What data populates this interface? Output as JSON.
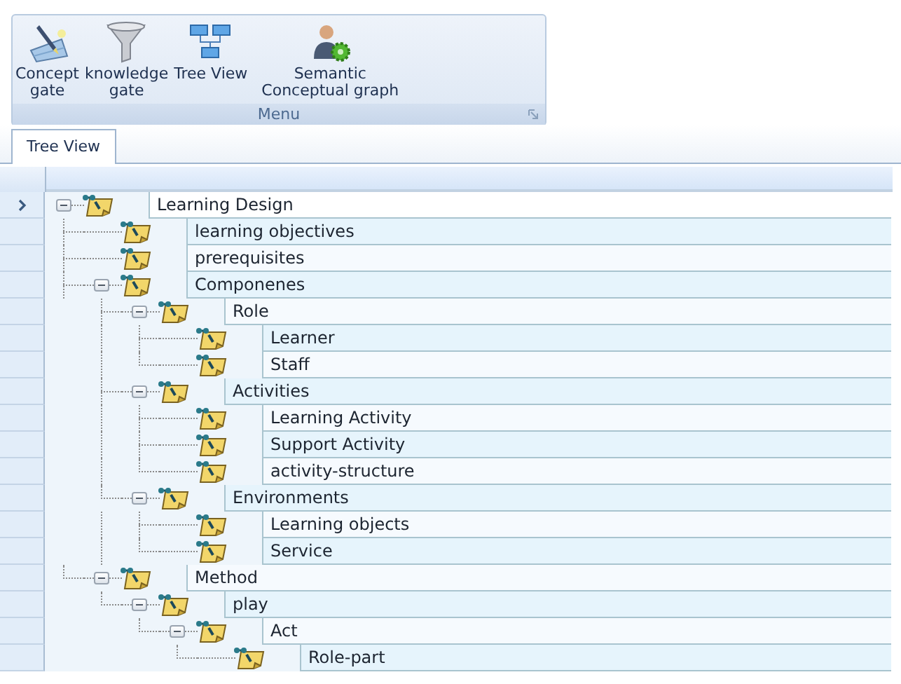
{
  "ribbon": {
    "buttons": [
      {
        "kind": "concept",
        "label": "Concept\ngate"
      },
      {
        "kind": "funnel",
        "label": "knowledge\ngate"
      },
      {
        "kind": "tree",
        "label": "Tree View"
      },
      {
        "kind": "person",
        "label": "Semantic\nConceptual graph"
      }
    ],
    "group_label": "Menu"
  },
  "tabs": [
    {
      "label": "Tree View",
      "selected": true
    }
  ],
  "tree": {
    "nodes": [
      {
        "label": "Learning Design",
        "expanded": true,
        "selected": true,
        "children": [
          {
            "label": "learning objectives",
            "selected": false
          },
          {
            "label": "prerequisites",
            "selected": false
          },
          {
            "label": "Componenes",
            "expanded": true,
            "selected": false,
            "children": [
              {
                "label": "Role",
                "expanded": true,
                "selected": false,
                "children": [
                  {
                    "label": "Learner",
                    "selected": false
                  },
                  {
                    "label": "Staff",
                    "selected": false
                  }
                ]
              },
              {
                "label": "Activities",
                "expanded": true,
                "selected": false,
                "children": [
                  {
                    "label": "Learning Activity",
                    "selected": false
                  },
                  {
                    "label": "Support Activity",
                    "selected": false
                  },
                  {
                    "label": "activity-structure",
                    "selected": false
                  }
                ]
              },
              {
                "label": "Environments",
                "expanded": true,
                "selected": false,
                "children": [
                  {
                    "label": "Learning objects",
                    "selected": false
                  },
                  {
                    "label": "Service",
                    "selected": false
                  }
                ]
              }
            ]
          },
          {
            "label": "Method",
            "expanded": true,
            "selected": false,
            "children": [
              {
                "label": "play",
                "expanded": true,
                "selected": false,
                "children": [
                  {
                    "label": "Act",
                    "expanded": true,
                    "selected": false,
                    "children": [
                      {
                        "label": "Role-part",
                        "selected": false
                      }
                    ]
                  }
                ]
              }
            ]
          }
        ]
      }
    ]
  }
}
